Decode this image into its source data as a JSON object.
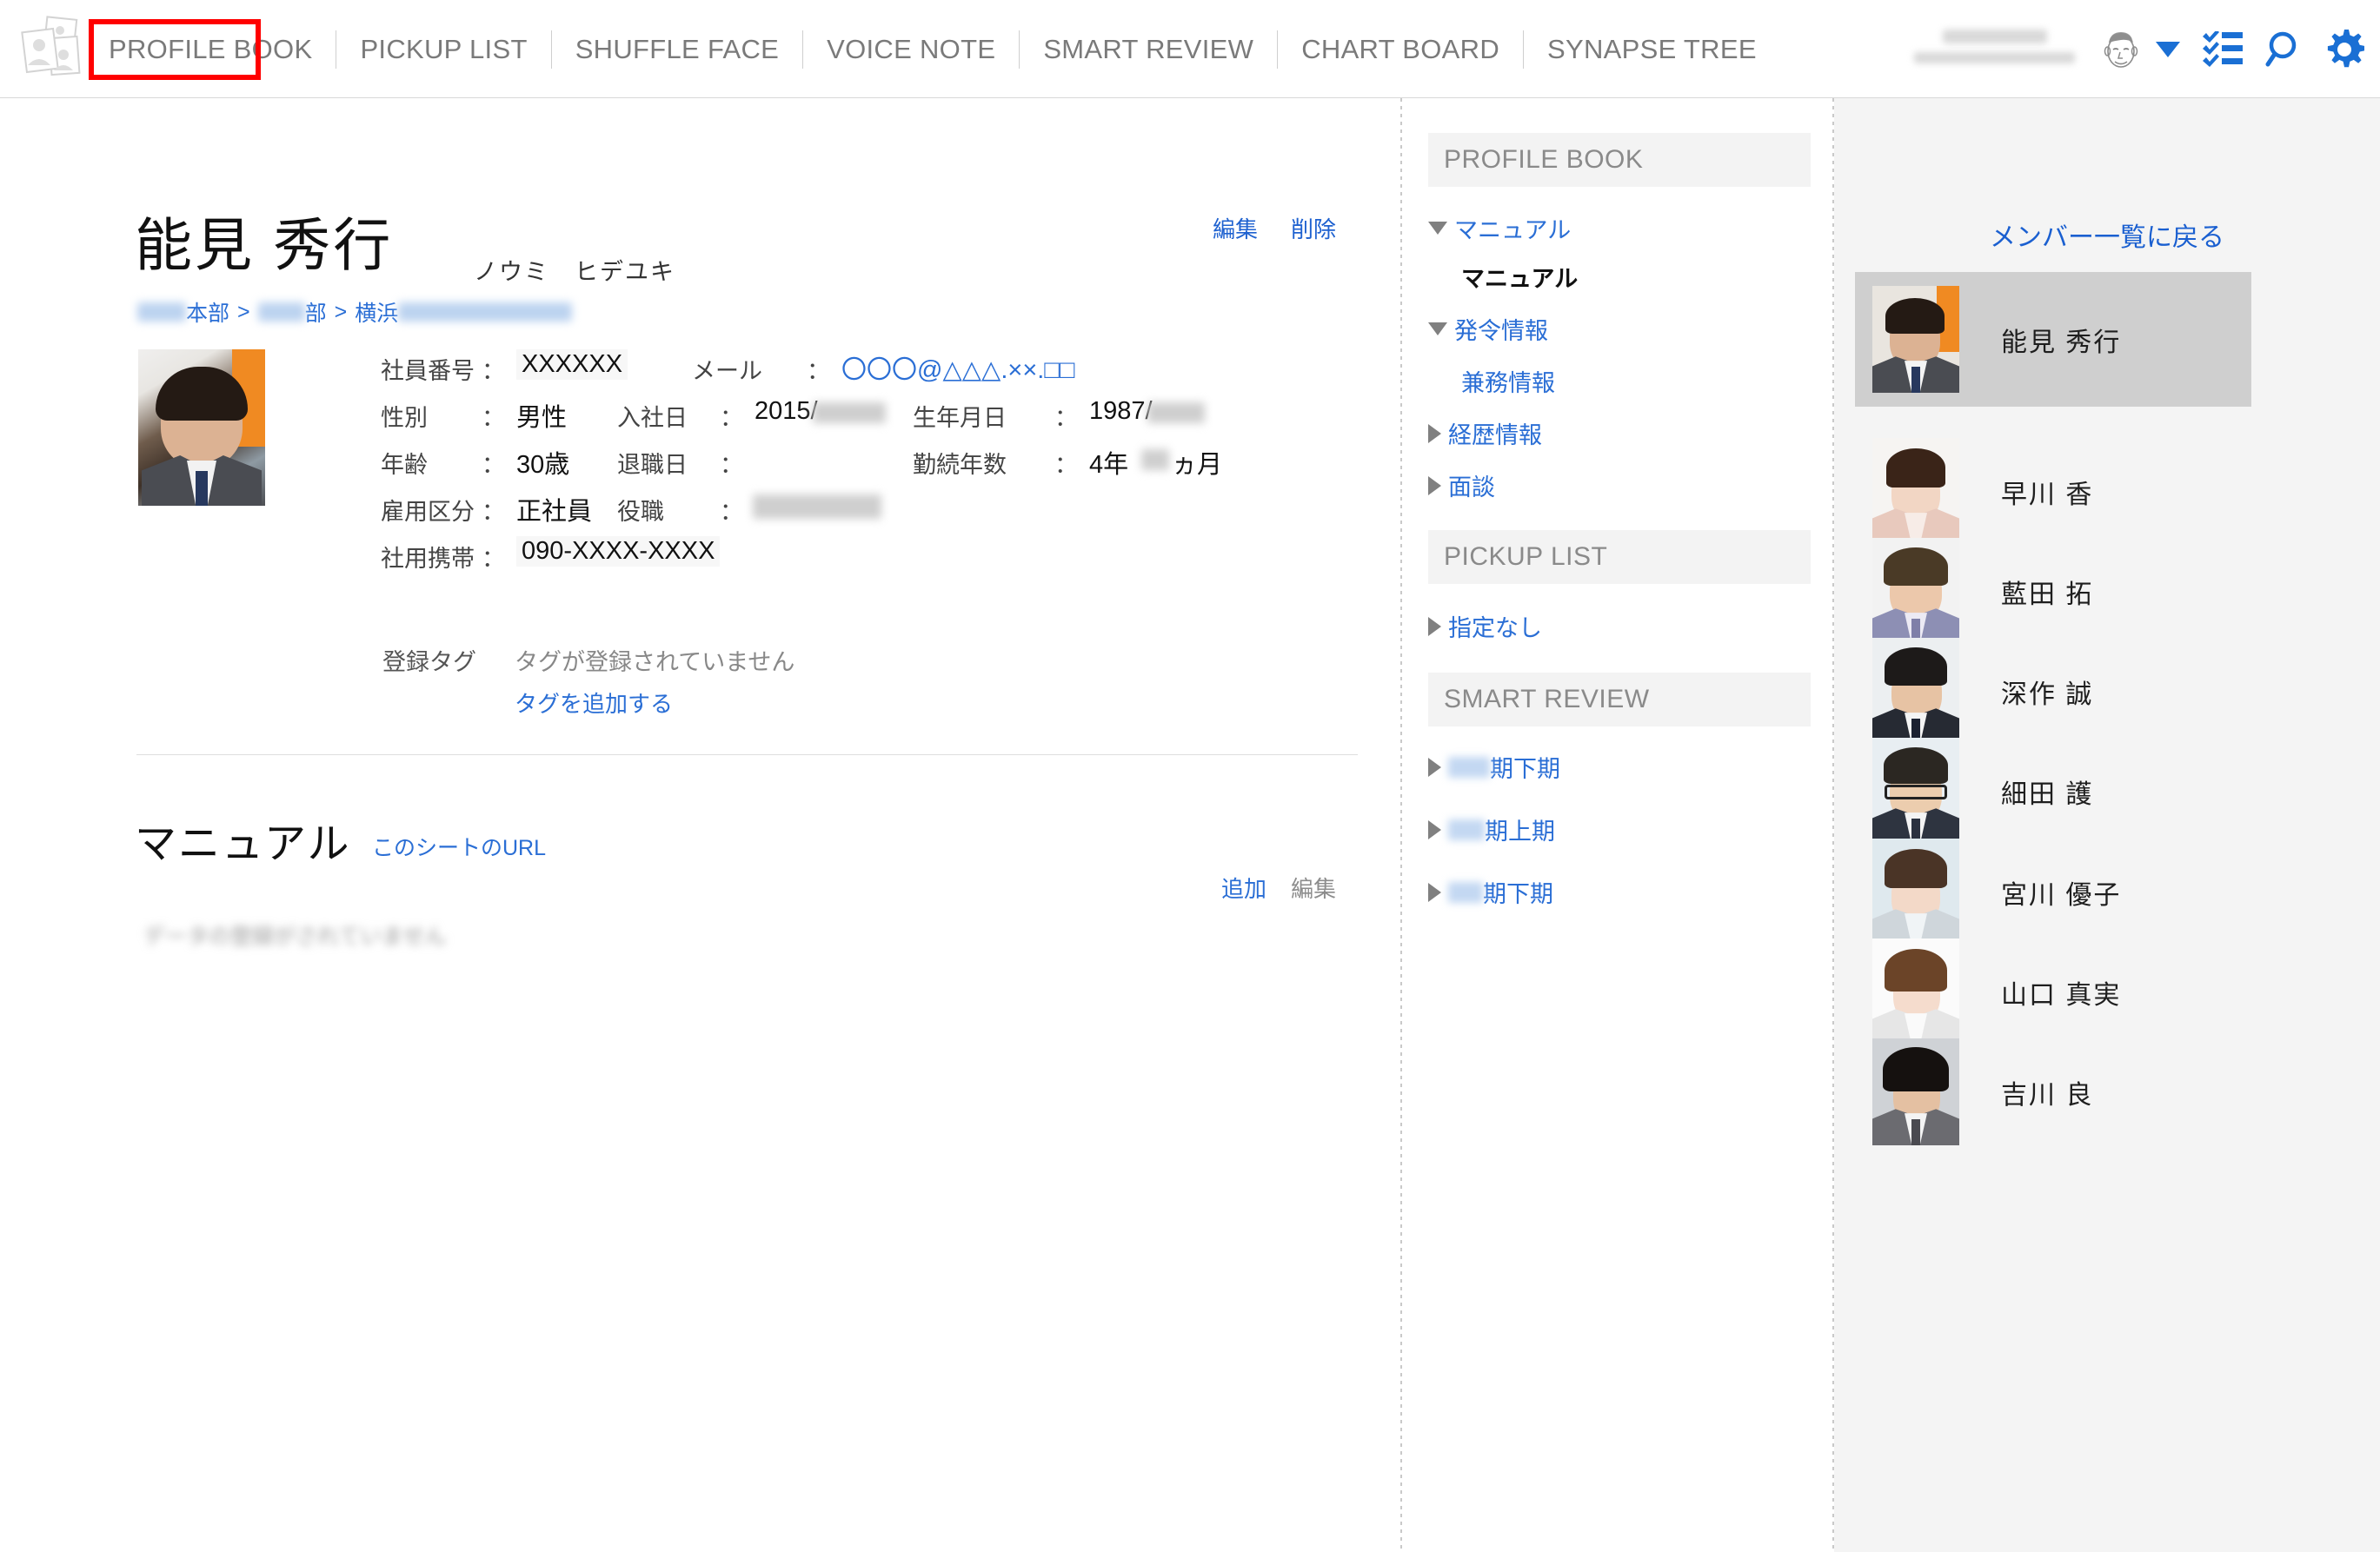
{
  "app": {
    "logo_icon": "photo-stack-icon"
  },
  "nav": {
    "tabs": [
      {
        "label": "PROFILE BOOK",
        "active": true
      },
      {
        "label": "PICKUP LIST",
        "active": false
      },
      {
        "label": "SHUFFLE FACE",
        "active": false
      },
      {
        "label": "VOICE NOTE",
        "active": false
      },
      {
        "label": "SMART REVIEW",
        "active": false
      },
      {
        "label": "CHART BOARD",
        "active": false
      },
      {
        "label": "SYNAPSE TREE",
        "active": false
      }
    ],
    "highlight_color": "#ff0000"
  },
  "header_icons": [
    {
      "name": "avatar"
    },
    {
      "name": "chevron-down-icon"
    },
    {
      "name": "checklist-icon"
    },
    {
      "name": "search-icon"
    },
    {
      "name": "gear-icon"
    }
  ],
  "profile": {
    "actions": [
      {
        "label": "編集"
      },
      {
        "label": "削除"
      }
    ],
    "name": "能見 秀行",
    "kana": "ノウミ　ヒデユキ",
    "breadcrumb": [
      {
        "text": "本部",
        "redacted_prefix": true
      },
      {
        "text": "部",
        "redacted_prefix": true
      },
      {
        "text": "横浜",
        "redacted_suffix": true
      }
    ],
    "breadcrumb_separator": ">",
    "fields": [
      {
        "label": "社員番号",
        "value": "XXXXXX",
        "style": "shade"
      },
      {
        "label": "メール",
        "value": "〇〇〇@△△△.××.□□",
        "style": "link"
      },
      {
        "label": "性別",
        "value": "男性",
        "style": "plain"
      },
      {
        "label": "入社日",
        "value": "2015/",
        "style": "redacted-tail"
      },
      {
        "label": "生年月日",
        "value": "1987/",
        "style": "redacted-tail"
      },
      {
        "label": "年齢",
        "value": "30歳",
        "style": "plain"
      },
      {
        "label": "退職日",
        "value": "",
        "style": "plain"
      },
      {
        "label": "勤続年数",
        "value": "4年",
        "style": "redacted-mid",
        "suffix": "ヵ月"
      },
      {
        "label": "雇用区分",
        "value": "正社員",
        "style": "plain"
      },
      {
        "label": "役職",
        "value": "",
        "style": "redacted"
      },
      {
        "label": "社用携帯",
        "value": "090-XXXX-XXXX",
        "style": "shade"
      }
    ],
    "tag_label": "登録タグ",
    "tag_empty_text": "タグが登録されていません",
    "tag_add_label": "タグを追加する"
  },
  "sheet": {
    "title": "マニュアル",
    "url_label": "このシートのURL",
    "add_label": "追加",
    "edit_label": "編集",
    "empty_text": "データの登録がされていません"
  },
  "sidebar": {
    "sections": [
      {
        "title": "PROFILE BOOK",
        "items": [
          {
            "label": "マニュアル",
            "arrow": "down",
            "level": 0,
            "current": false
          },
          {
            "label": "マニュアル",
            "arrow": "none",
            "level": 1,
            "current": true
          },
          {
            "label": "発令情報",
            "arrow": "down",
            "level": 0,
            "current": false
          },
          {
            "label": "兼務情報",
            "arrow": "none",
            "level": 1,
            "current": false
          },
          {
            "label": "経歴情報",
            "arrow": "right",
            "level": 0,
            "current": false
          },
          {
            "label": "面談",
            "arrow": "right",
            "level": 0,
            "current": false
          }
        ]
      },
      {
        "title": "PICKUP LIST",
        "items": [
          {
            "label": "指定なし",
            "arrow": "right",
            "level": 0,
            "current": false
          }
        ]
      },
      {
        "title": "SMART REVIEW",
        "items": [
          {
            "label": "期下期",
            "arrow": "right",
            "level": 0,
            "current": false,
            "redacted_prefix": true
          },
          {
            "label": "期上期",
            "arrow": "right",
            "level": 0,
            "current": false,
            "redacted_prefix": true
          },
          {
            "label": "期下期",
            "arrow": "right",
            "level": 0,
            "current": false,
            "redacted_prefix": true
          }
        ]
      }
    ]
  },
  "member_panel": {
    "back_label": "メンバー一覧に戻る",
    "members": [
      {
        "name": "能見 秀行",
        "selected": true,
        "hair": "#241a14",
        "skin": "#dcb293",
        "bg": "#e9e5df",
        "suit": "#4a4c52",
        "tie": "#27385e",
        "glasses": false
      },
      {
        "name": "早川 香",
        "selected": false,
        "hair": "#3a2418",
        "skin": "#f2d6c4",
        "bg": "#f6f4f2",
        "suit": "#e8c9bd",
        "tie": "",
        "glasses": false
      },
      {
        "name": "藍田 拓",
        "selected": false,
        "hair": "#4a3a26",
        "skin": "#ecc8ab",
        "bg": "#f2f2f2",
        "suit": "#8d8fb4",
        "tie": "#7f7fa8",
        "glasses": false
      },
      {
        "name": "深作 誠",
        "selected": false,
        "hair": "#1d1a19",
        "skin": "#e7c3a4",
        "bg": "#eceff1",
        "suit": "#262a33",
        "tie": "#1b2030",
        "glasses": false
      },
      {
        "name": "細田 護",
        "selected": false,
        "hair": "#2b2722",
        "skin": "#eccdae",
        "bg": "#e8eef2",
        "suit": "#2e3440",
        "tie": "#2b3140",
        "glasses": true
      },
      {
        "name": "宮川 優子",
        "selected": false,
        "hair": "#4a3426",
        "skin": "#f3d9c8",
        "bg": "#dfe9ee",
        "suit": "#cfd6db",
        "tie": "",
        "glasses": false
      },
      {
        "name": "山口 真実",
        "selected": false,
        "hair": "#6b4428",
        "skin": "#f5dccd",
        "bg": "#fbfbfb",
        "suit": "#e6e6e6",
        "tie": "",
        "glasses": false
      },
      {
        "name": "吉川 良",
        "selected": false,
        "hair": "#15110f",
        "skin": "#e4c0a2",
        "bg": "#cfd2d6",
        "suit": "#6b6b70",
        "tie": "#4a4a50",
        "glasses": false
      }
    ]
  }
}
